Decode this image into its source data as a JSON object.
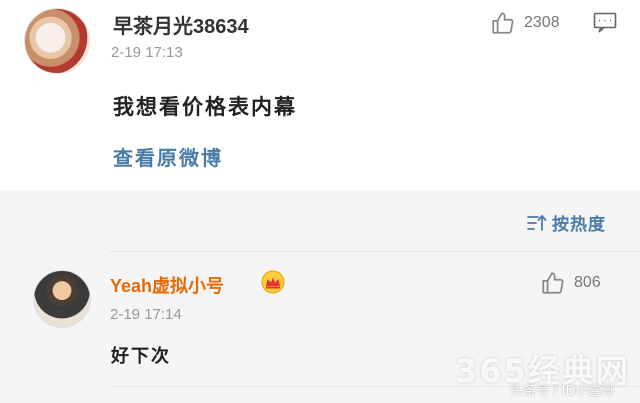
{
  "comment_main": {
    "username": "早茶月光38634",
    "timestamp": "2-19 17:13",
    "text": "我想看价格表内幕",
    "view_original_link": "查看原微博",
    "like_count": "2308"
  },
  "sort": {
    "label": "按热度"
  },
  "reply": {
    "username": "Yeah虚拟小号",
    "timestamp": "2-19 17:14",
    "text": "好下次",
    "like_count": "806"
  },
  "watermark": {
    "main": "365经典网",
    "sub": "头条号 / ID小嘉哥"
  },
  "colors": {
    "link_blue": "#4a7ca8",
    "vip_orange": "#e86a06",
    "timestamp_gray": "#999999"
  },
  "icons": {
    "like": "thumbs-up-icon",
    "reply": "comment-icon",
    "sort": "sort-icon",
    "vip": "crown-icon"
  }
}
